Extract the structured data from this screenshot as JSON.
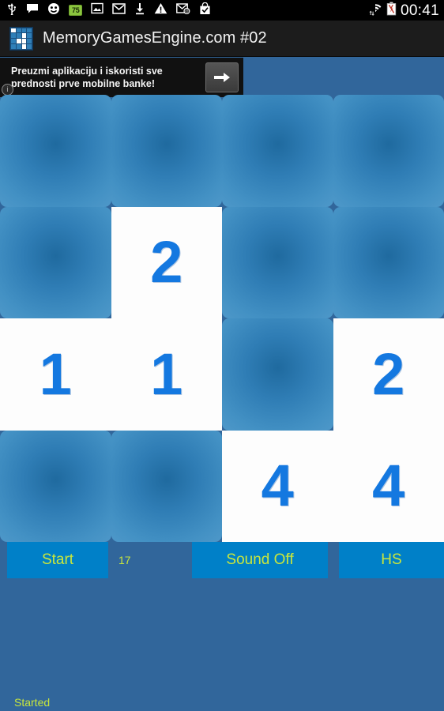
{
  "statusbar": {
    "time": "00:41",
    "battery_badge": "75",
    "icons": [
      {
        "name": "usb-icon",
        "glyph": "usb"
      },
      {
        "name": "message-icon",
        "glyph": "chat"
      },
      {
        "name": "hangouts-icon",
        "glyph": "smiley"
      },
      {
        "name": "battery-level-badge",
        "glyph": "badge"
      },
      {
        "name": "screenshot-icon",
        "glyph": "picture"
      },
      {
        "name": "gmail-icon",
        "glyph": "M"
      },
      {
        "name": "download-icon",
        "glyph": "download"
      },
      {
        "name": "warning-icon",
        "glyph": "triangle"
      },
      {
        "name": "email-at-icon",
        "glyph": "envelope-at"
      },
      {
        "name": "shopping-bag-check-icon",
        "glyph": "bag"
      }
    ],
    "right_icons": [
      {
        "name": "wifi-icon",
        "glyph": "wifi"
      },
      {
        "name": "battery-icon",
        "glyph": "battery"
      }
    ]
  },
  "titlebar": {
    "title": "MemoryGamesEngine.com #02",
    "icon_name": "app-grid-icon"
  },
  "ad": {
    "text": "Preuzmi aplikaciju i iskoristi sve prednosti prve mobilne banke!",
    "arrow_label": "→",
    "info_label": "i"
  },
  "grid": {
    "columns": 4,
    "rows": 4,
    "tiles": [
      {
        "value": "",
        "revealed": false
      },
      {
        "value": "",
        "revealed": false
      },
      {
        "value": "",
        "revealed": false
      },
      {
        "value": "",
        "revealed": false
      },
      {
        "value": "",
        "revealed": false
      },
      {
        "value": "2",
        "revealed": true
      },
      {
        "value": "",
        "revealed": false
      },
      {
        "value": "",
        "revealed": false
      },
      {
        "value": "1",
        "revealed": true
      },
      {
        "value": "1",
        "revealed": true
      },
      {
        "value": "",
        "revealed": false
      },
      {
        "value": "2",
        "revealed": true
      },
      {
        "value": "",
        "revealed": false
      },
      {
        "value": "",
        "revealed": false
      },
      {
        "value": "4",
        "revealed": true
      },
      {
        "value": "4",
        "revealed": true
      }
    ]
  },
  "controls": {
    "start_label": "Start",
    "counter_value": "17",
    "sound_label": "Sound Off",
    "hs_label": "HS"
  },
  "status": {
    "message": "Started"
  },
  "colors": {
    "background": "#31669B",
    "tile_blue": "#2F7DB5",
    "tile_open": "#FDFDFD",
    "number_blue": "#1478E0",
    "button_blue": "#0080C8",
    "button_text": "#C8E63C",
    "titlebar": "#1C1C1C"
  }
}
